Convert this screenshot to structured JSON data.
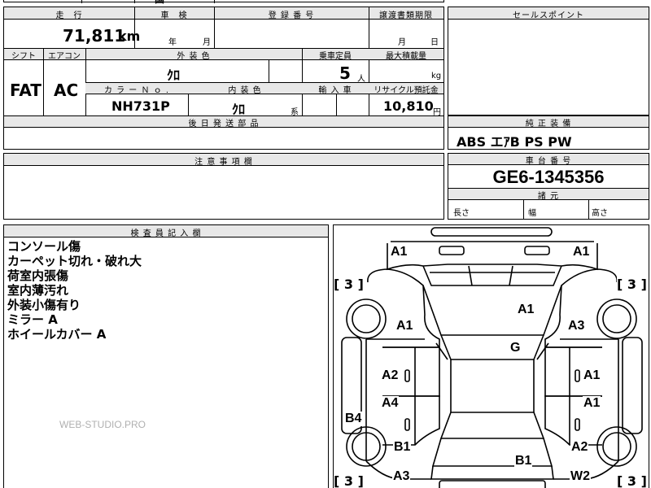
{
  "top_cut": {
    "left": "",
    "center": "国",
    "center2": "",
    "right": ""
  },
  "mileage": {
    "label": "走　行",
    "value": "71,811",
    "unit": "km"
  },
  "inspection": {
    "label": "車　検",
    "year_unit": "年",
    "month_unit": "月"
  },
  "registration": {
    "label": "登 録 番 号",
    "value": ""
  },
  "transfer_docs": {
    "label": "譲渡書類期限",
    "month_unit": "月",
    "day_unit": "日"
  },
  "sales_point": {
    "label": "セールスポイント",
    "text": ""
  },
  "shift": {
    "label": "シフト",
    "value": "FAT"
  },
  "aircon": {
    "label": "エアコン",
    "value": "AC"
  },
  "exterior_color": {
    "label": "外 装 色",
    "value": "ｸﾛ"
  },
  "capacity": {
    "label": "乗車定員",
    "value": "5",
    "unit": "人"
  },
  "max_load": {
    "label": "最大積載量",
    "value": "",
    "unit": "kg"
  },
  "color_no": {
    "label": "カ ラ ー Ｎ ｏ .",
    "value": "NH731P"
  },
  "interior_color": {
    "label": "内 装 色",
    "value": "ｸﾛ",
    "suffix": "系"
  },
  "import_car": {
    "label": "輸 入 車"
  },
  "recycle": {
    "label": "リサイクル預託金",
    "value": "10,810",
    "unit": "円"
  },
  "later_parts": {
    "label": "後 日 発 送 部 品",
    "text": ""
  },
  "factory_equipment": {
    "label": "純 正 装 備",
    "value": "ABS エｱB PS PW"
  },
  "notes": {
    "label": "注 意 事 項 欄",
    "text": ""
  },
  "chassis": {
    "label": "車 台 番 号",
    "value": "GE6-1345356"
  },
  "dimensions": {
    "label": "諸 元",
    "length": "長さ",
    "width": "幅",
    "height": "高さ"
  },
  "inspector": {
    "label": "検 査 員 記 入 欄",
    "lines": [
      "コンソール傷",
      "カーペット切れ・破れ大",
      "荷室内張傷",
      "室内薄汚れ",
      "外装小傷有り",
      "ミラー A",
      "ホイールカバー A"
    ],
    "watermark": "WEB-STUDIO.PRO"
  },
  "diagram": {
    "tire_left_front": "[ 3 ]",
    "tire_right_front": "[ 3 ]",
    "tire_left_rear": "[ 3 ]",
    "tire_right_rear": "[ 3 ]",
    "codes": {
      "front_left_top": "A1",
      "front_right_top": "A1",
      "hood": "A1",
      "front_fender_left": "A1",
      "front_fender_right": "A3",
      "roof": "G",
      "front_door_left": "A2",
      "front_door_right": "A1",
      "rear_door_left": "A4",
      "rear_door_right": "A1",
      "sill_left": "B4",
      "rear_fender_left": "B1",
      "rear_fender_right": "A2",
      "rear_left_bottom": "A3",
      "trunk": "B1",
      "rear_window": "W2"
    }
  }
}
